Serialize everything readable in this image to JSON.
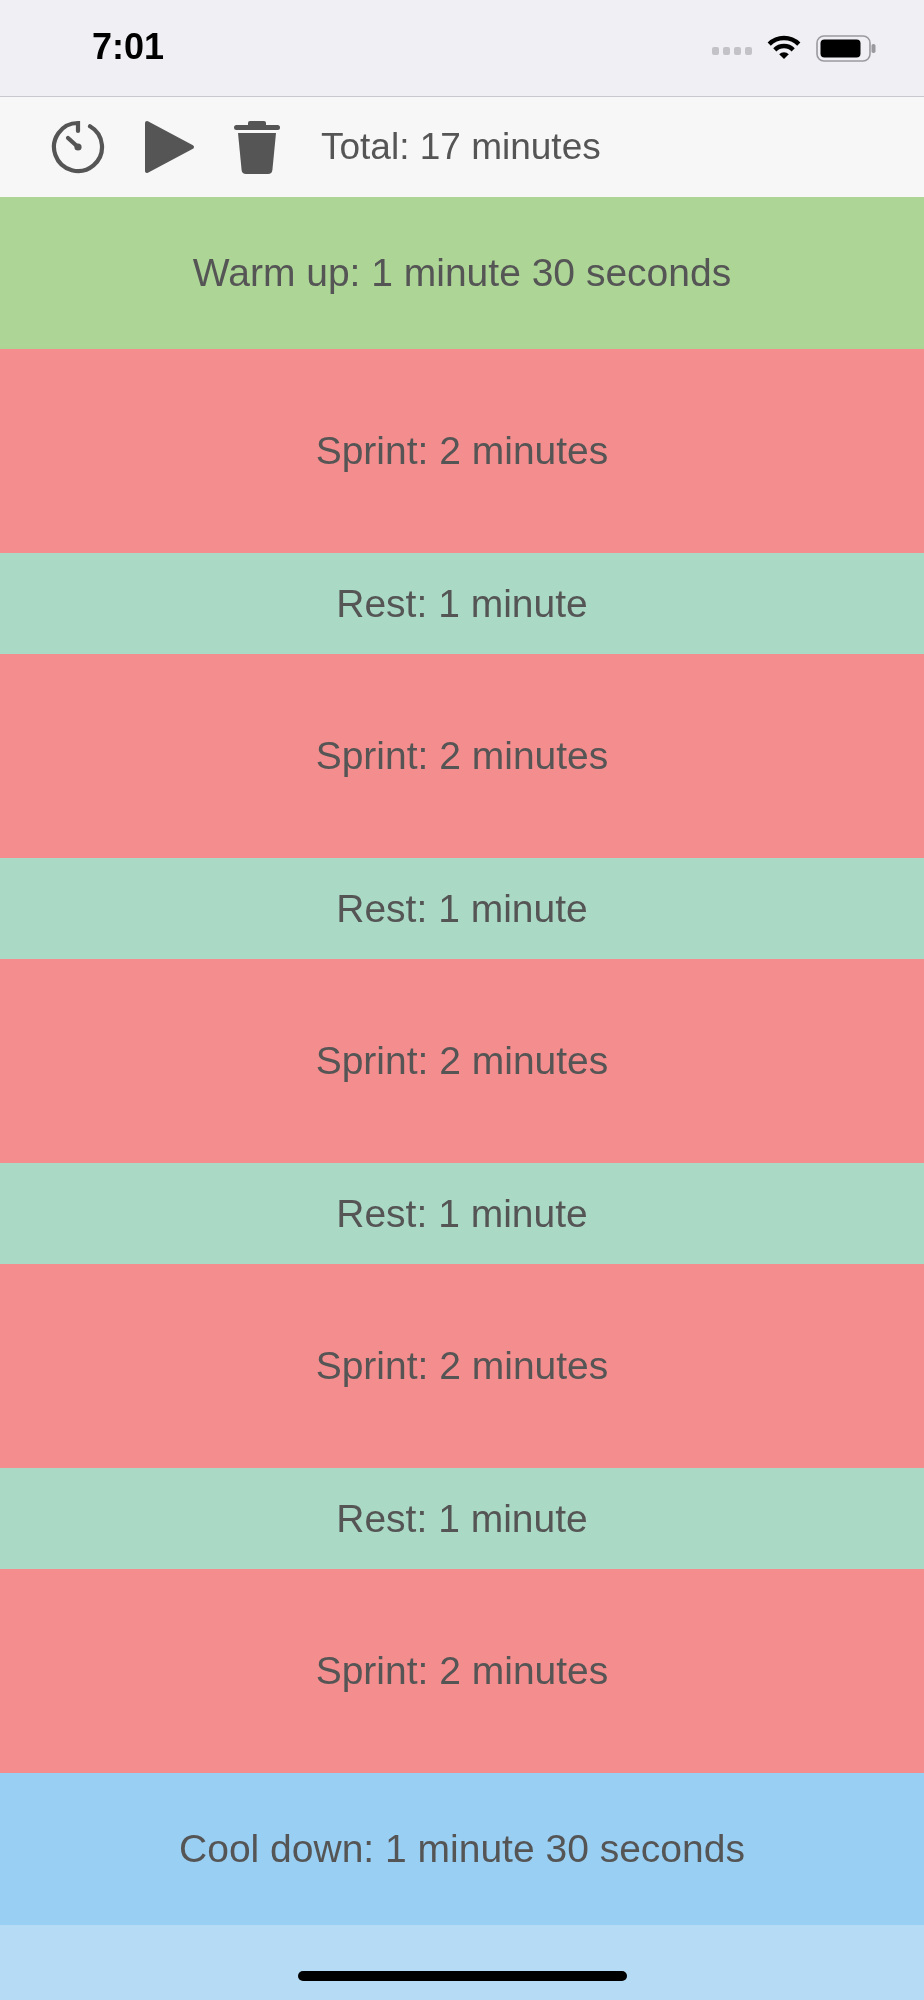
{
  "status_bar": {
    "time": "7:01"
  },
  "toolbar": {
    "total": "Total: 17 minutes"
  },
  "segments": [
    {
      "kind": "warmup",
      "label": "Warm up: 1 minute 30 seconds",
      "color": "#acd596"
    },
    {
      "kind": "sprint",
      "label": "Sprint: 2 minutes",
      "color": "#f48d8d"
    },
    {
      "kind": "rest",
      "label": "Rest: 1 minute",
      "color": "#aadac6"
    },
    {
      "kind": "sprint",
      "label": "Sprint: 2 minutes",
      "color": "#f48d8d"
    },
    {
      "kind": "rest",
      "label": "Rest: 1 minute",
      "color": "#aadac6"
    },
    {
      "kind": "sprint",
      "label": "Sprint: 2 minutes",
      "color": "#f48d8d"
    },
    {
      "kind": "rest",
      "label": "Rest: 1 minute",
      "color": "#aadac6"
    },
    {
      "kind": "sprint",
      "label": "Sprint: 2 minutes",
      "color": "#f48d8d"
    },
    {
      "kind": "rest",
      "label": "Rest: 1 minute",
      "color": "#aadac6"
    },
    {
      "kind": "sprint",
      "label": "Sprint: 2 minutes",
      "color": "#f48d8d"
    },
    {
      "kind": "cooldown",
      "label": "Cool down: 1 minute 30 seconds",
      "color": "#99cff3"
    }
  ]
}
